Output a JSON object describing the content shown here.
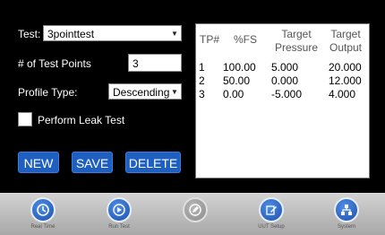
{
  "form": {
    "test_label": "Test:",
    "test_value": "3pointtest",
    "points_label": "# of Test Points",
    "points_value": "3",
    "profile_label": "Profile Type:",
    "profile_value": "Descending",
    "leak_label": "Perform Leak Test"
  },
  "actions": {
    "new": "NEW",
    "save": "SAVE",
    "delete": "DELETE"
  },
  "table": {
    "headers": [
      "TP#",
      "%FS",
      "Target\nPressure",
      "Target\nOutput"
    ],
    "rows": [
      [
        "1",
        "100.00",
        "5.000",
        "20.000"
      ],
      [
        "2",
        "50.00",
        "0.000",
        "12.000"
      ],
      [
        "3",
        "0.00",
        "-5.000",
        "4.000"
      ]
    ]
  },
  "toolbar": [
    {
      "label": "Real Time",
      "icon": "clock-icon",
      "disabled": false
    },
    {
      "label": "Run Test",
      "icon": "play-icon",
      "disabled": false
    },
    {
      "label": "",
      "icon": "edit-icon",
      "disabled": true
    },
    {
      "label": "UUT Setup",
      "icon": "settings-edit-icon",
      "disabled": false
    },
    {
      "label": "System",
      "icon": "network-icon",
      "disabled": false
    }
  ],
  "colors": {
    "button_blue": "#1f5fbf",
    "toolbar_gray": "#bcbcbc"
  }
}
